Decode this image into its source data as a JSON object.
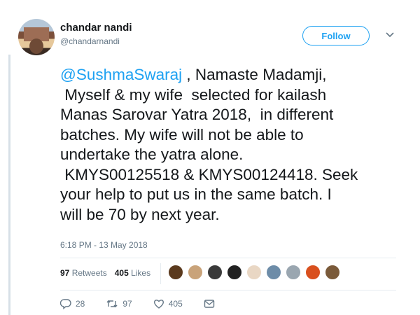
{
  "user": {
    "name": "chandar nandi",
    "handle": "@chandarnandi"
  },
  "follow_label": "Follow",
  "tweet": {
    "mention": "@SushmaSwaraj",
    "line1_rest": " , Namaste Madamji,",
    "line2": " Myself & my wife  selected for kailash",
    "line3": "Manas Sarovar Yatra 2018,  in different",
    "line4": "batches. My wife will not be able to",
    "line5": "undertake the yatra alone.",
    "line6": " KMYS00125518 & KMYS00124418. Seek",
    "line7": "your help to put us in the same batch. I",
    "line8": "will be 70 by next year."
  },
  "timestamp": "6:18 PM - 13 May 2018",
  "stats": {
    "retweets_count": "97",
    "retweets_label": " Retweets",
    "likes_count": "405",
    "likes_label": " Likes"
  },
  "likers": [
    {
      "icon": "liker-avatar-1",
      "color": "#5b3a1e"
    },
    {
      "icon": "liker-avatar-2",
      "color": "#c9a37a"
    },
    {
      "icon": "liker-avatar-3",
      "color": "#3a3a3a"
    },
    {
      "icon": "liker-avatar-4",
      "color": "#222222"
    },
    {
      "icon": "liker-avatar-5",
      "color": "#e9d7c4"
    },
    {
      "icon": "liker-avatar-6",
      "color": "#6d8ca8"
    },
    {
      "icon": "liker-avatar-7",
      "color": "#9aa6b0"
    },
    {
      "icon": "liker-avatar-8",
      "color": "#d9501e"
    },
    {
      "icon": "liker-avatar-9",
      "color": "#7a5a3a"
    }
  ],
  "actions": {
    "reply_count": "28",
    "retweet_count": "97",
    "like_count": "405"
  },
  "colors": {
    "accent": "#1da1f2",
    "text": "#14171a",
    "muted": "#657786"
  }
}
